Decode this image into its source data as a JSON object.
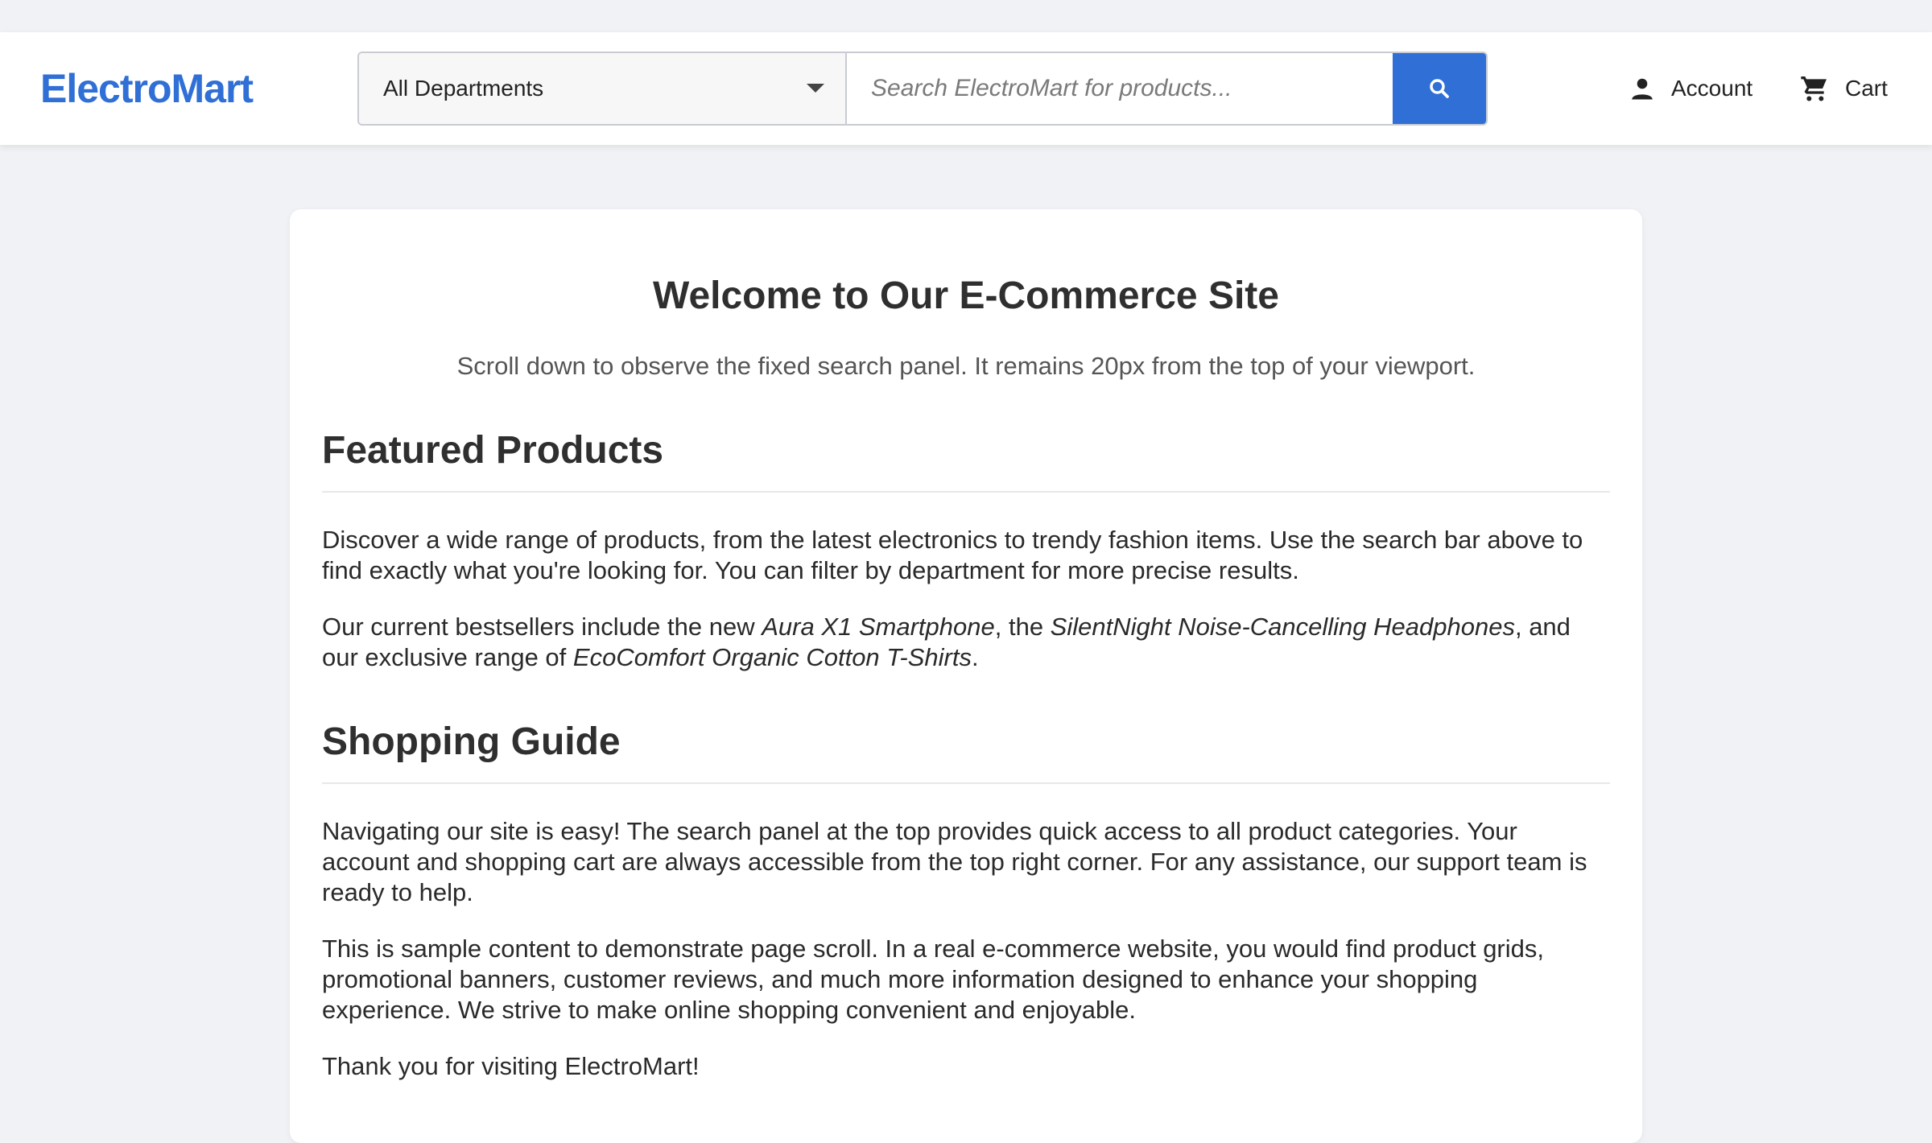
{
  "brand": {
    "name": "ElectroMart",
    "color": "#2f6fd6"
  },
  "search": {
    "department_selected": "All Departments",
    "placeholder": "Search ElectroMart for products...",
    "value": "",
    "button_icon": "search-icon",
    "button_color": "#2f6fd6"
  },
  "header_actions": {
    "account": {
      "label": "Account",
      "icon": "person-icon"
    },
    "cart": {
      "label": "Cart",
      "icon": "shopping-cart-icon"
    }
  },
  "main": {
    "title": "Welcome to Our E-Commerce Site",
    "subtitle": "Scroll down to observe the fixed search panel. It remains 20px from the top of your viewport.",
    "featured": {
      "heading": "Featured Products",
      "paragraph1": "Discover a wide range of products, from the latest electronics to trendy fashion items. Use the search bar above to find exactly what you're looking for. You can filter by department for more precise results.",
      "paragraph2": {
        "t1": "Our current bestsellers include the new ",
        "product1": "Aura X1 Smartphone",
        "t2": ", the ",
        "product2": "SilentNight Noise-Cancelling Headphones",
        "t3": ", and our exclusive range of ",
        "product3": "EcoComfort Organic Cotton T-Shirts",
        "t4": "."
      }
    },
    "guide": {
      "heading": "Shopping Guide",
      "paragraph1": "Navigating our site is easy! The search panel at the top provides quick access to all product categories. Your account and shopping cart are always accessible from the top right corner. For any assistance, our support team is ready to help.",
      "paragraph2": "This is sample content to demonstrate page scroll. In a real e-commerce website, you would find product grids, promotional banners, customer reviews, and much more information designed to enhance your shopping experience. We strive to make online shopping convenient and enjoyable.",
      "paragraph3": "Thank you for visiting ElectroMart!"
    }
  }
}
